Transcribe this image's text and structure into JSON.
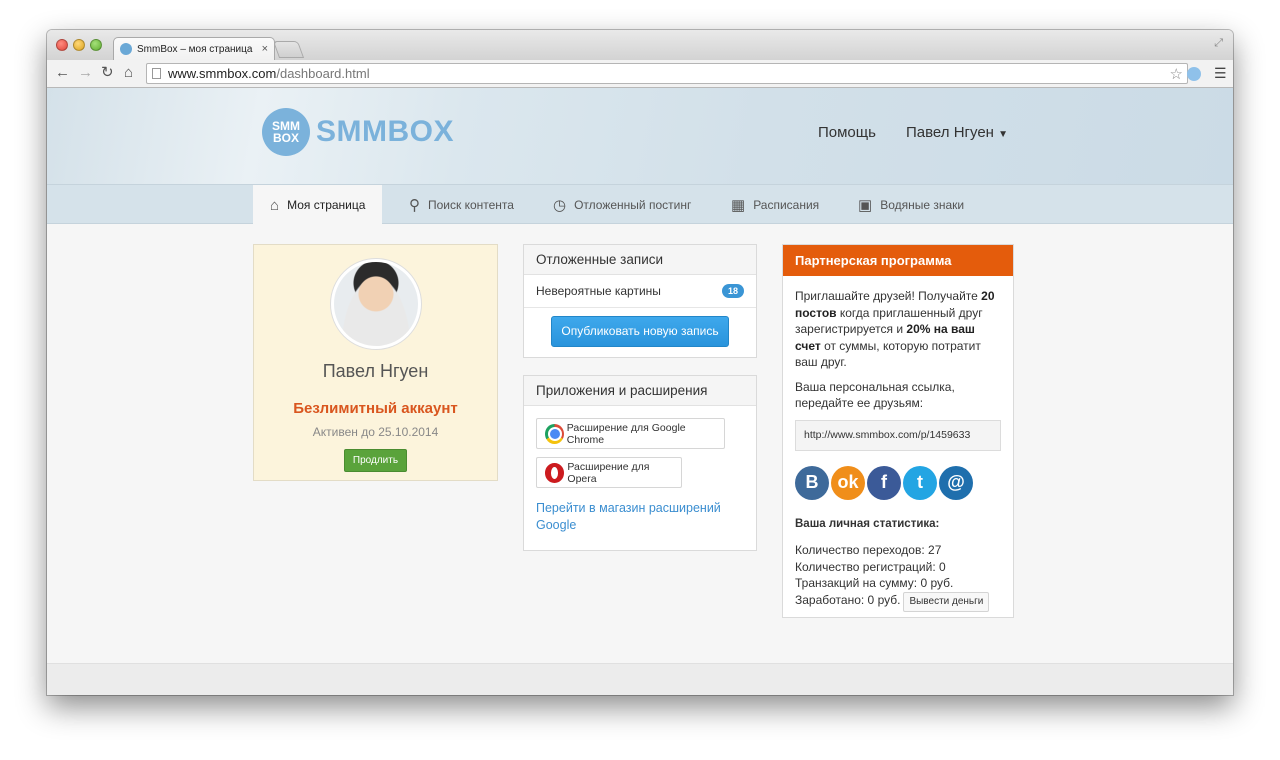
{
  "browser": {
    "tab_title": "SmmBox – моя страница",
    "tab_close": "×",
    "url_domain": "www.smmbox.com",
    "url_path": "/dashboard.html",
    "back_icon": "arrow-left-icon",
    "forward_icon": "arrow-right-icon",
    "reload_icon": "reload-icon",
    "home_icon": "home-icon"
  },
  "header": {
    "logo_badge_line1": "SMM",
    "logo_badge_line2": "BOX",
    "logo_text": "SMMBOX",
    "help_link": "Помощь",
    "user_menu": "Павел Нгуен"
  },
  "nav": {
    "items": [
      {
        "label": "Моя страница",
        "icon": "home-icon",
        "active": true
      },
      {
        "label": "Поиск контента",
        "icon": "search-icon",
        "active": false
      },
      {
        "label": "Отложенный постинг",
        "icon": "stopwatch-icon",
        "active": false
      },
      {
        "label": "Расписания",
        "icon": "calendar-icon",
        "active": false
      },
      {
        "label": "Водяные знаки",
        "icon": "image-icon",
        "active": false
      }
    ]
  },
  "profile": {
    "name": "Павел Нгуен",
    "account_type": "Безлимитный аккаунт",
    "active_until": "Активен до 25.10.2014",
    "extend_button": "Продлить"
  },
  "deferred": {
    "title": "Отложенные записи",
    "row_label": "Невероятные картины",
    "row_count": "18",
    "publish_button": "Опубликовать новую запись"
  },
  "apps": {
    "title": "Приложения и расширения",
    "chrome_button": "Расширение для Google Chrome",
    "opera_button": "Расширение для Opera",
    "store_link": "Перейти в магазин расширений Google"
  },
  "partner": {
    "title": "Партнерская программа",
    "intro_a": "Приглашайте друзей! Получайте ",
    "intro_b": "20 постов",
    "intro_c": " когда приглашенный друг зарегистрируется и ",
    "intro_d": "20% на ваш счет",
    "intro_e": " от суммы, которую потратит ваш друг.",
    "link_label": "Ваша персональная ссылка, передайте ее друзьям:",
    "ref_link": "http://www.smmbox.com/p/1459633",
    "socials": [
      "vk-icon",
      "odnoklassniki-icon",
      "facebook-icon",
      "twitter-icon",
      "mail-icon"
    ],
    "stats_title": "Ваша личная статистика:",
    "clicks": "Количество переходов: 27",
    "registrations": "Количество регистраций: 0",
    "transactions": "Транзакций на сумму: 0 руб.",
    "earned": "Заработано: 0 руб.",
    "withdraw_button": "Вывести деньги"
  },
  "colors": {
    "accent_blue": "#3a95d5",
    "account_orange": "#d9561f",
    "partner_header": "#e45c0c",
    "extend_green": "#5aa33b",
    "profile_bg": "#fcf4dc"
  }
}
